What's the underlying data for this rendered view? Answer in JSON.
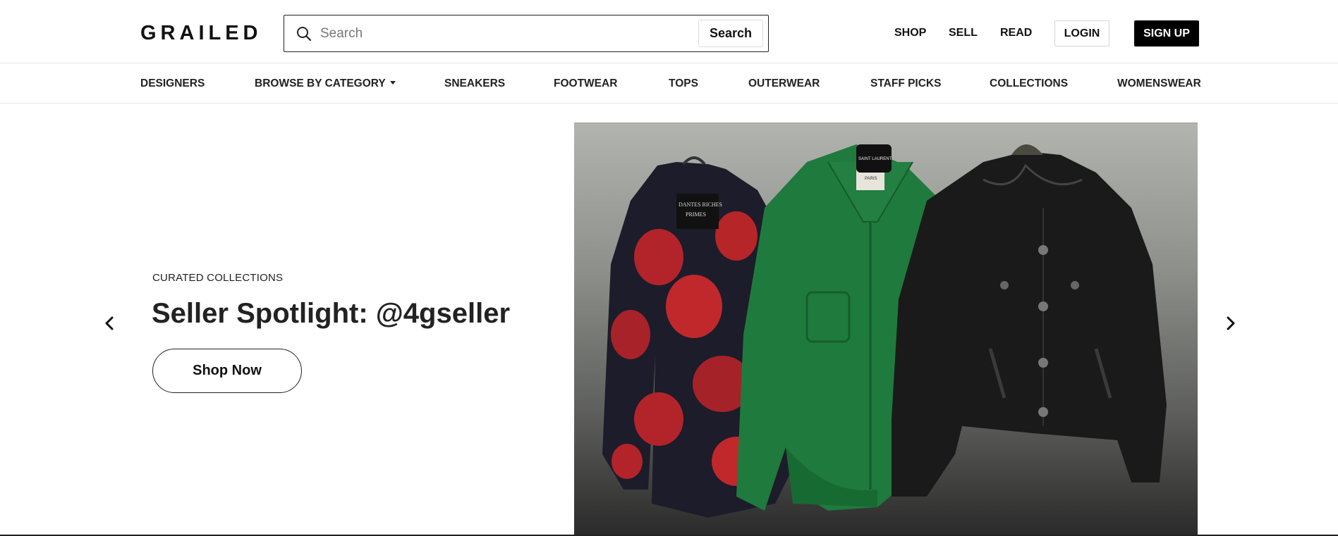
{
  "header": {
    "logo": "GRAILED",
    "search": {
      "placeholder": "Search",
      "value": "",
      "button_label": "Search"
    },
    "links": {
      "shop": "SHOP",
      "sell": "SELL",
      "read": "READ"
    },
    "login_label": "LOGIN",
    "signup_label": "SIGN UP"
  },
  "category_nav": {
    "items": [
      {
        "label": "DESIGNERS"
      },
      {
        "label": "BROWSE BY CATEGORY",
        "has_dropdown": true
      },
      {
        "label": "SNEAKERS"
      },
      {
        "label": "FOOTWEAR"
      },
      {
        "label": "TOPS"
      },
      {
        "label": "OUTERWEAR"
      },
      {
        "label": "STAFF PICKS"
      },
      {
        "label": "COLLECTIONS"
      },
      {
        "label": "WOMENSWEAR"
      }
    ]
  },
  "hero": {
    "eyebrow": "CURATED COLLECTIONS",
    "title": "Seller Spotlight: @4gseller",
    "cta_label": "Shop Now",
    "prev_icon": "chevron-left-icon",
    "next_icon": "chevron-right-icon",
    "image": {
      "garments": [
        "red floral sheer shirt",
        "green leather jacket",
        "black leather jacket"
      ],
      "label_texts": [
        "DANTES RICHES",
        "PRIMES",
        "SAINT LAURENT",
        "PARIS"
      ]
    }
  },
  "colors": {
    "text": "#111111",
    "signup_bg": "#000000",
    "border": "#e6e6e6",
    "floral_red": "#c0282c",
    "leather_green": "#1f7a3d",
    "leather_black": "#1a1a1a"
  }
}
